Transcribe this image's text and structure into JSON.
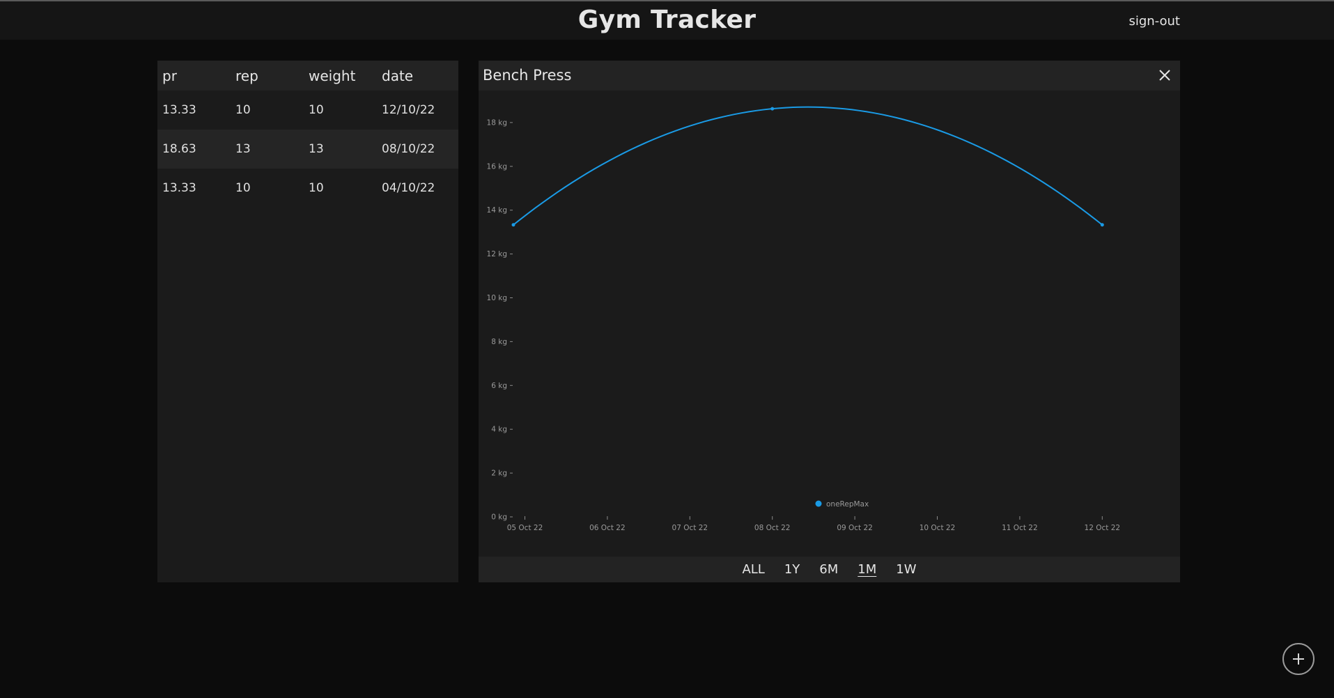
{
  "app": {
    "title": "Gym Tracker",
    "signout_label": "sign-out"
  },
  "table": {
    "headers": [
      "pr",
      "rep",
      "weight",
      "date"
    ],
    "rows": [
      [
        "13.33",
        "10",
        "10",
        "12/10/22"
      ],
      [
        "18.63",
        "13",
        "13",
        "08/10/22"
      ],
      [
        "13.33",
        "10",
        "10",
        "04/10/22"
      ]
    ]
  },
  "chart_panel": {
    "title": "Bench Press",
    "close_icon": "close-icon",
    "ranges": [
      "ALL",
      "1Y",
      "6M",
      "1M",
      "1W"
    ],
    "active_range": "1M"
  },
  "chart_data": {
    "type": "line",
    "series": [
      {
        "name": "oneRepMax",
        "points": [
          {
            "date": "04 Oct 22",
            "value": 13.33
          },
          {
            "date": "08 Oct 22",
            "value": 18.63
          },
          {
            "date": "12 Oct 22",
            "value": 13.33
          }
        ]
      }
    ],
    "x_ticks": [
      "05 Oct 22",
      "06 Oct 22",
      "07 Oct 22",
      "08 Oct 22",
      "09 Oct 22",
      "10 Oct 22",
      "11 Oct 22",
      "12 Oct 22"
    ],
    "y_ticks": [
      "0 kg",
      "2 kg",
      "4 kg",
      "6 kg",
      "8 kg",
      "10 kg",
      "12 kg",
      "14 kg",
      "16 kg",
      "18 kg"
    ],
    "ylim": [
      0,
      18.63
    ],
    "legend_position": "bottom-center",
    "line_color": "#1a9be6"
  },
  "fab": {
    "icon": "plus-icon"
  }
}
